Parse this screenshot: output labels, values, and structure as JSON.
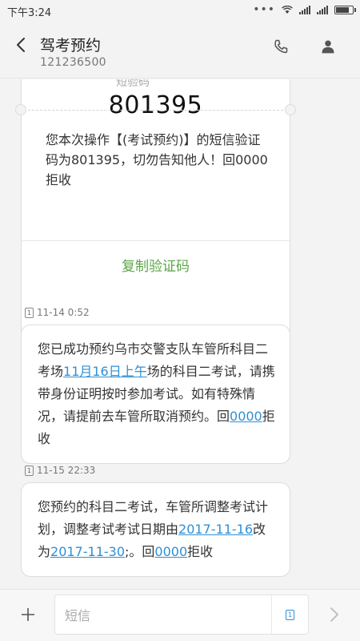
{
  "status_bar": {
    "time": "下午3:24",
    "icons": [
      "more-dots-icon",
      "wifi-icon",
      "signal-icon",
      "signal-icon",
      "battery-icon"
    ]
  },
  "header": {
    "title": "驾考预约",
    "number": "121236500",
    "icons": [
      "back-icon",
      "phone-icon",
      "contact-icon"
    ]
  },
  "card": {
    "partial_label": "短验码",
    "code": "801395",
    "body": "您本次操作【(考试预约)】的短信验证码为801395，切勿告知他人！回0000拒收",
    "copy_button": "复制验证码"
  },
  "messages": [
    {
      "sim": "1",
      "timestamp": "11-14 0:52",
      "parts": {
        "a": "您已成功预约乌市交警支队车管所科目二考场",
        "link1": "11月16日上午",
        "b": "场的科目二考试，请携带身份证明按时参加考试。如有特殊情况，请提前去车管所取消预约。回",
        "link2": "0000",
        "c": "拒收"
      }
    },
    {
      "sim": "1",
      "timestamp": "11-15 22:33",
      "parts": {
        "a": "您预约的科目二考试，车管所调整考试计划，调整考试考试日期由",
        "link1": "2017-11-16",
        "b": "改为",
        "link2": "2017-11-30",
        "c": ";。回",
        "link3": "0000",
        "d": "拒收"
      }
    }
  ],
  "input": {
    "placeholder": "短信",
    "sim": "1"
  },
  "colors": {
    "background": "#f3f3f3",
    "link": "#2f8fd6",
    "copy_button": "#5aa545"
  }
}
